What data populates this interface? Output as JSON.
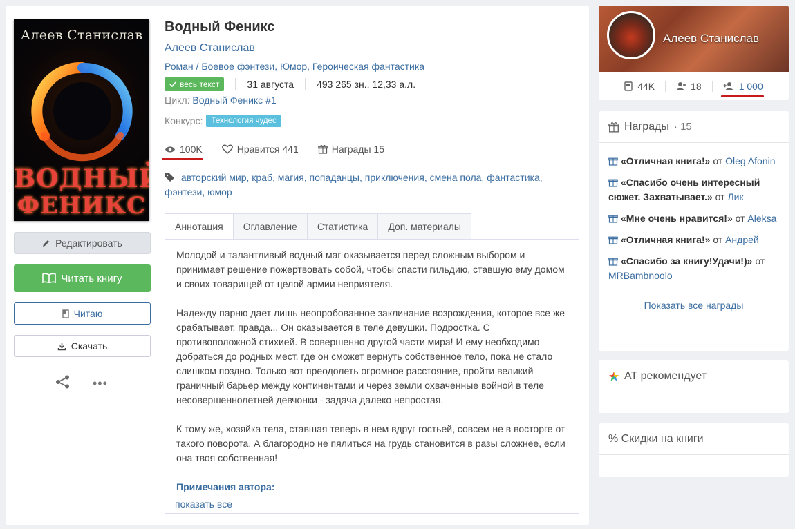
{
  "book": {
    "title": "Водный Феникс",
    "author": "Алеев Станислав",
    "genres": "Роман / Боевое фэнтези, Юмор, Героическая фантастика",
    "status_badge": "весь текст",
    "date": "31 августа",
    "size": "493 265 зн., 12,33",
    "size_unit": "а.л.",
    "cycle_label": "Цикл:",
    "cycle_value": "Водный Феникс #1",
    "contest_label": "Конкурс:",
    "contest_value": "Технология чудес",
    "cover_author": "Алеев Станислав",
    "cover_title_1": "ВОДНЫЙ",
    "cover_title_2": "ФЕНИКС"
  },
  "stats": {
    "views": "100K",
    "likes": "Нравится 441",
    "awards": "Награды 15"
  },
  "tags": "авторский мир, краб, магия, попаданцы, приключения, смена пола, фантастика, фэнтези, юмор",
  "buttons": {
    "edit": "Редактировать",
    "read": "Читать книгу",
    "reading": "Читаю",
    "download": "Скачать"
  },
  "tabs": [
    "Аннотация",
    "Оглавление",
    "Статистика",
    "Доп. материалы"
  ],
  "annotation": {
    "p1": "Молодой и талантливый водный маг оказывается перед сложным выбором и принимает решение пожертвовать собой, чтобы спасти гильдию, ставшую ему домом и своих товарищей от целой армии неприятеля.",
    "p2": "Надежду парню дает лишь неопробованное заклинание возрождения, которое все же срабатывает, правда... Он оказывается в теле девушки. Подростка. С противоположной стихией. В совершенно другой части мира! И ему необходимо добраться до родных мест, где он сможет вернуть собственное тело, пока не стало слишком поздно. Только вот преодолеть огромное расстояние, пройти великий граничный барьер между континентами и через земли охваченные войной в теле несовершеннолетней девчонки - задача далеко непростая.",
    "p3": "К тому же, хозяйка тела, ставшая теперь в нем вдруг гостьей, совсем не в восторге от такого поворота. А благородно не пялиться на грудь становится в разы сложнее, если она твоя собственная!",
    "notes_title": "Примечания автора:",
    "show_all": "показать все"
  },
  "profile": {
    "name": "Алеев Станислав",
    "books_stat": "44K",
    "friends_stat": "18",
    "followers_stat": "1 000"
  },
  "awards_card": {
    "title": "Награды",
    "count": "· 15",
    "items": [
      {
        "text": "«Отличная книга!»",
        "from": "от",
        "user": "Oleg Afonin"
      },
      {
        "text": "«Спасибо очень интересный сюжет. Захватывает.»",
        "from": "от",
        "user": "Лик"
      },
      {
        "text": "«Мне очень нравится!»",
        "from": "от",
        "user": "Aleksa"
      },
      {
        "text": "«Отличная книга!»",
        "from": "от",
        "user": "Андрей"
      },
      {
        "text": "«Спасибо за книгу!Удачи!)»",
        "from": "от",
        "user": "MRBambnoolo"
      }
    ],
    "show_all": "Показать все награды"
  },
  "recommends": {
    "title": "АТ рекомендует"
  },
  "discounts": {
    "title": "% Скидки на книги"
  },
  "colors": {
    "accent": "#3b6da0",
    "green": "#5cb85c",
    "contest": "#5bc0de",
    "highlight": "#c81a1a"
  }
}
